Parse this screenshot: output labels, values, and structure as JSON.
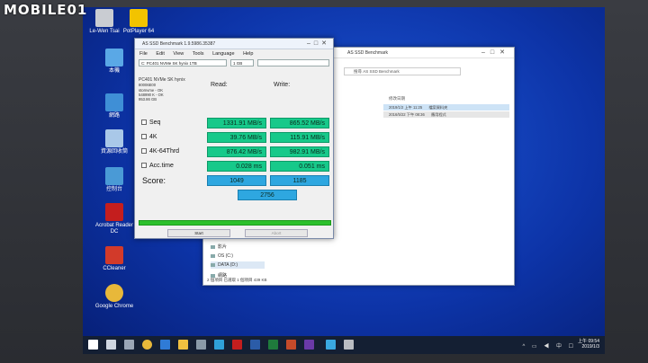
{
  "watermark": "MOBILE01",
  "desktop": {
    "icons": [
      {
        "name": "Le-Wen Tsai",
        "color": "#c9ccd2"
      },
      {
        "name": "PotPlayer 64",
        "color": "#f2c300"
      },
      {
        "name": "本機",
        "color": "#5aa8e6"
      },
      {
        "name": "網路",
        "color": "#3f8fd6"
      },
      {
        "name": "資源回收筒",
        "color": "#a9c8e8"
      },
      {
        "name": "控制台",
        "color": "#4a9ad6"
      },
      {
        "name": "Acrobat Reader DC",
        "color": "#c41e1e"
      },
      {
        "name": "CCleaner",
        "color": "#d23a2a"
      },
      {
        "name": "Google Chrome",
        "color": "#e8b83a"
      }
    ]
  },
  "asssd": {
    "title": "AS SSD Benchmark 1.9.5986.35387",
    "menu": [
      "File",
      "Edit",
      "View",
      "Tools",
      "Language",
      "Help"
    ],
    "drive_select": "C: PC401 NVMe SK hynix 1TB",
    "size_select": "1 GB",
    "drive_info": [
      "PC401 NVMe SK hynix",
      "80006E00",
      "stornvme - OK",
      "548990 K - OK",
      "953.86 GB"
    ],
    "read_label": "Read:",
    "write_label": "Write:",
    "rows": [
      {
        "label": "Seq",
        "read": "1331.91 MB/s",
        "write": "865.52 MB/s"
      },
      {
        "label": "4K",
        "read": "39.76 MB/s",
        "write": "115.91 MB/s"
      },
      {
        "label": "4K-64Thrd",
        "read": "876.42 MB/s",
        "write": "982.91 MB/s"
      },
      {
        "label": "Acc.time",
        "read": "0.028 ms",
        "write": "0.051 ms"
      }
    ],
    "score_label": "Score:",
    "score_read": "1049",
    "score_write": "1185",
    "score_total": "2756",
    "progress_percent": 100,
    "start_button": "Start",
    "abort_button": "Abort"
  },
  "explorer": {
    "title": "AS SSD Benchmark",
    "search_placeholder": "搜尋 AS SSD Benchmark",
    "col_modified": "修改日期",
    "files": [
      {
        "date": "2019/1/2 上午 11:25",
        "type": "檔案資料夾"
      },
      {
        "date": "2016/5/22 下午 08:36",
        "type": "應用程式"
      }
    ],
    "nav": [
      "影片",
      "OS (C:)",
      "DATA (D:)",
      "網路"
    ],
    "status": "2 個項目    已選取 1 個項目 439 KB"
  },
  "taskbar": {
    "time": "上午 09:54",
    "date": "2019/1/3"
  }
}
